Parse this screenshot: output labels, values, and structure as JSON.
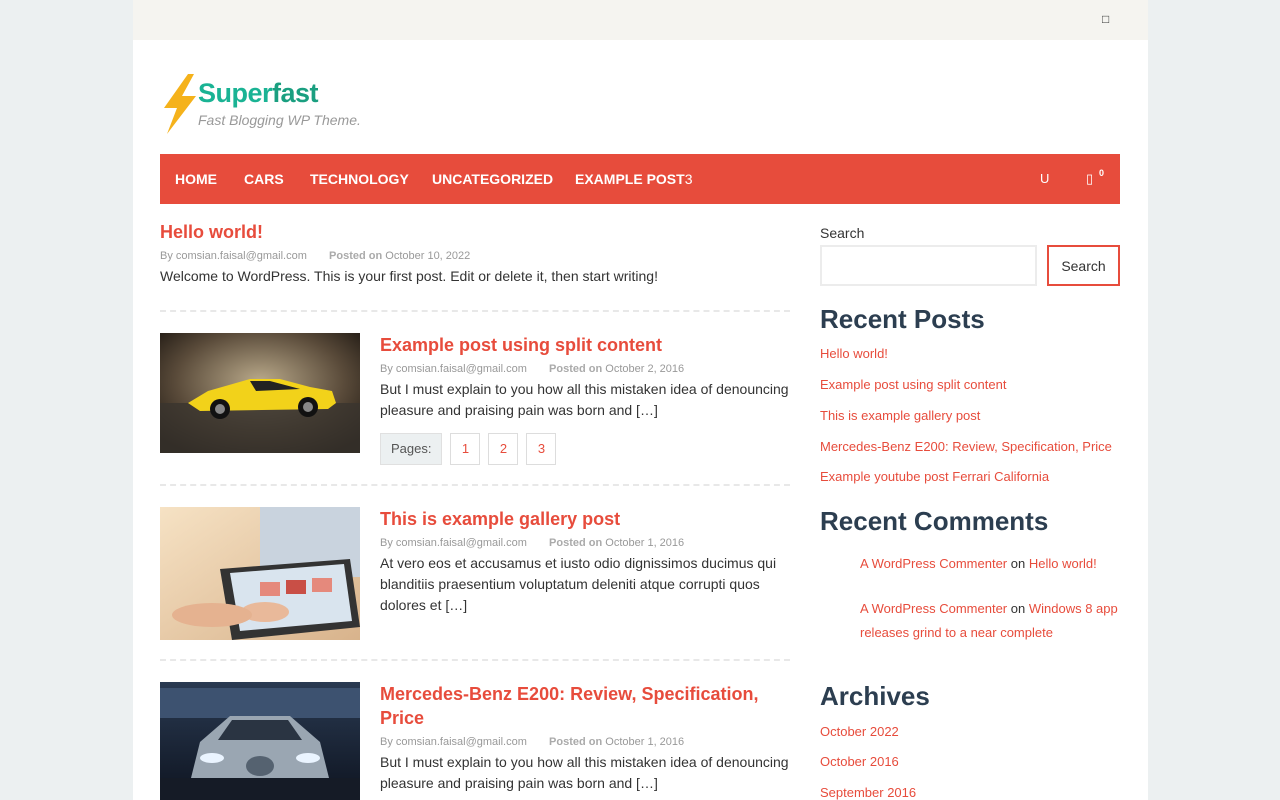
{
  "topbar": {
    "icon": "search-icon"
  },
  "logo": {
    "name_part1": "Super",
    "name_part2": "fast",
    "tagline": "Fast Blogging WP Theme."
  },
  "nav": {
    "items": [
      "HOME",
      "CARS",
      "TECHNOLOGY",
      "UNCATEGORIZED",
      "EXAMPLE POST"
    ],
    "dropdown_marker": "3",
    "icons": {
      "user": "U",
      "cart": "▯",
      "cart_count": "0"
    }
  },
  "posts": [
    {
      "title": "Hello world!",
      "author_prefix": "By",
      "author": "comsian.faisal@gmail.com",
      "date_prefix": "Posted on",
      "date": "October 10, 2022",
      "excerpt": "Welcome to WordPress. This is your first post. Edit or delete it, then start writing!"
    },
    {
      "title": "Example post using split content",
      "author_prefix": "By",
      "author": "comsian.faisal@gmail.com",
      "date_prefix": "Posted on",
      "date": "October 2, 2016",
      "excerpt": "But I must explain to you how all this mistaken idea of denouncing pleasure and praising pain was born and […]",
      "pages_label": "Pages:",
      "pages": [
        "1",
        "2",
        "3"
      ]
    },
    {
      "title": "This is example gallery post",
      "author_prefix": "By",
      "author": "comsian.faisal@gmail.com",
      "date_prefix": "Posted on",
      "date": "October 1, 2016",
      "excerpt": "At vero eos et accusamus et iusto odio dignissimos ducimus qui blanditiis praesentium voluptatum deleniti atque corrupti quos dolores et […]"
    },
    {
      "title": "Mercedes-Benz E200: Review, Specification, Price",
      "author_prefix": "By",
      "author": "comsian.faisal@gmail.com",
      "date_prefix": "Posted on",
      "date": "October 1, 2016",
      "excerpt": "But I must explain to you how all this mistaken idea of denouncing pleasure and praising pain was born and […]"
    }
  ],
  "sidebar": {
    "search_label": "Search",
    "search_button": "Search",
    "recent_posts_title": "Recent Posts",
    "recent_posts": [
      "Hello world!",
      "Example post using split content",
      "This is example gallery post",
      "Mercedes-Benz E200: Review, Specification, Price",
      "Example youtube post Ferrari California"
    ],
    "recent_comments_title": "Recent Comments",
    "recent_comments": [
      {
        "author": "A WordPress Commenter",
        "on": "on",
        "post": "Hello world!"
      },
      {
        "author": "A WordPress Commenter",
        "on": "on",
        "post": "Windows 8 app releases grind to a near complete"
      }
    ],
    "archives_title": "Archives",
    "archives": [
      "October 2022",
      "October 2016",
      "September 2016"
    ]
  },
  "colors": {
    "accent": "#e74c3c",
    "heading": "#2c3e50",
    "brand": "#1ab394"
  }
}
